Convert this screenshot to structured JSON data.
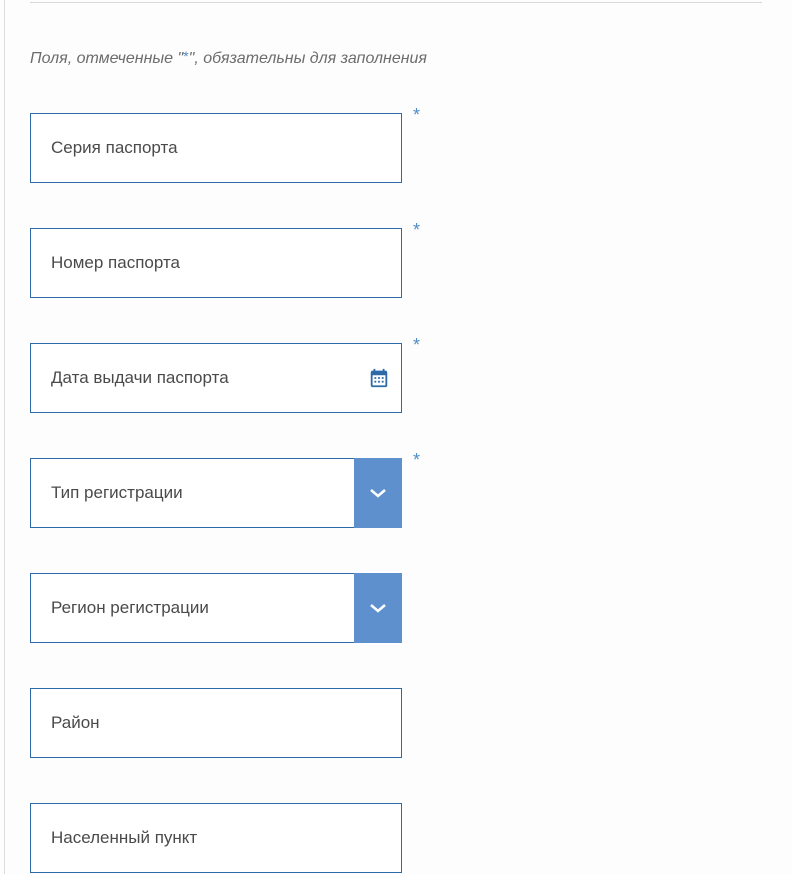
{
  "hint": {
    "prefix": "Поля, отмеченные \"",
    "marker": "*",
    "suffix": "\", обязательны для заполнения"
  },
  "fields": {
    "passport_series": {
      "placeholder": "Серия паспорта"
    },
    "passport_number": {
      "placeholder": "Номер паспорта"
    },
    "passport_issue_date": {
      "placeholder": "Дата выдачи паспорта"
    },
    "registration_type": {
      "placeholder": "Тип регистрации"
    },
    "registration_region": {
      "placeholder": "Регион регистрации"
    },
    "district": {
      "placeholder": "Район"
    },
    "settlement": {
      "placeholder": "Населенный пункт"
    }
  },
  "required_marker": "*"
}
